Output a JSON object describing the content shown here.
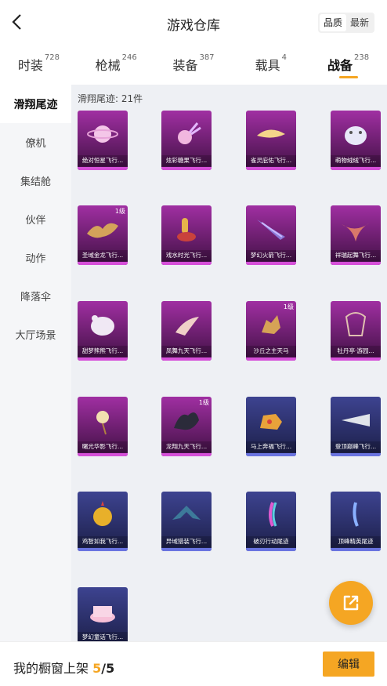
{
  "header": {
    "title": "游戏仓库",
    "sort_quality": "品质",
    "sort_latest": "最新"
  },
  "tabs": [
    {
      "label": "时装",
      "count": "728"
    },
    {
      "label": "枪械",
      "count": "246"
    },
    {
      "label": "装备",
      "count": "387"
    },
    {
      "label": "载具",
      "count": "4"
    },
    {
      "label": "战备",
      "count": "238"
    }
  ],
  "sidebar": [
    {
      "label": "滑翔尾迹"
    },
    {
      "label": "僚机"
    },
    {
      "label": "集结舱"
    },
    {
      "label": "伙伴"
    },
    {
      "label": "动作"
    },
    {
      "label": "降落伞"
    },
    {
      "label": "大厅场景"
    }
  ],
  "content": {
    "count_text": "滑翔尾迹: 21件"
  },
  "items": [
    {
      "name": "绝对恒星飞行...",
      "rarity": "purple",
      "icon": "planet-icon",
      "level": ""
    },
    {
      "name": "炫彩糖果飞行...",
      "rarity": "purple",
      "icon": "candy-icon",
      "level": ""
    },
    {
      "name": "雀灵庇佑飞行...",
      "rarity": "purple",
      "icon": "bird-icon",
      "level": ""
    },
    {
      "name": "萌物绒绒飞行...",
      "rarity": "purple",
      "icon": "plush-icon",
      "level": ""
    },
    {
      "name": "圣域金龙飞行...",
      "rarity": "purple",
      "icon": "dragon-icon",
      "level": "1级"
    },
    {
      "name": "戏水时光飞行...",
      "rarity": "purple",
      "icon": "giraffe-icon",
      "level": ""
    },
    {
      "name": "梦幻火箭飞行...",
      "rarity": "purple",
      "icon": "wing-icon",
      "level": ""
    },
    {
      "name": "祥瑞起舞飞行...",
      "rarity": "purple",
      "icon": "ribbon-icon",
      "level": ""
    },
    {
      "name": "甜梦熊熊飞行...",
      "rarity": "purple",
      "icon": "bear-icon",
      "level": ""
    },
    {
      "name": "凤舞九天飞行...",
      "rarity": "purple",
      "icon": "feather-icon",
      "level": ""
    },
    {
      "name": "沙丘之主天马",
      "rarity": "purple",
      "icon": "pegasus-icon",
      "level": "1级"
    },
    {
      "name": "牡丹亭·游园...",
      "rarity": "purple",
      "icon": "lantern-icon",
      "level": ""
    },
    {
      "name": "曙光华影飞行...",
      "rarity": "purple",
      "icon": "flower-icon",
      "level": ""
    },
    {
      "name": "龙翔九天飞行...",
      "rarity": "purple",
      "icon": "black-dragon-icon",
      "level": "1级"
    },
    {
      "name": "马上奔福飞行...",
      "rarity": "blue",
      "icon": "horse-icon",
      "level": ""
    },
    {
      "name": "登顶巅峰飞行...",
      "rarity": "blue",
      "icon": "jet-icon",
      "level": ""
    },
    {
      "name": "鸡智如我飞行...",
      "rarity": "blue",
      "icon": "chick-icon",
      "level": ""
    },
    {
      "name": "异域猎装飞行...",
      "rarity": "blue",
      "icon": "mech-wing-icon",
      "level": ""
    },
    {
      "name": "破刃行动尾迹",
      "rarity": "blue",
      "icon": "rainbow-trail-icon",
      "level": ""
    },
    {
      "name": "顶峰精英尾迹",
      "rarity": "blue",
      "icon": "blue-trail-icon",
      "level": ""
    },
    {
      "name": "梦幻童话飞行...",
      "rarity": "blue",
      "icon": "cake-icon",
      "level": ""
    }
  ],
  "footer": {
    "label": "我的橱窗上架",
    "current": "5",
    "separator": "/",
    "total": "5",
    "edit_label": "编辑"
  },
  "colors": {
    "accent": "#f5a623",
    "purple_rarity": "#a02fa2",
    "blue_rarity": "#3d4390"
  }
}
